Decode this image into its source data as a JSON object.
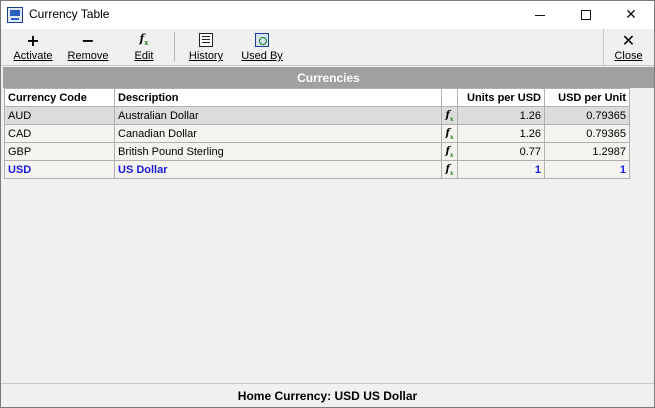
{
  "window": {
    "title": "Currency Table",
    "app_icon": "currency-window-icon"
  },
  "toolbar": {
    "activate": {
      "label": "Activate",
      "icon": "plus-icon"
    },
    "remove": {
      "label": "Remove",
      "icon": "minus-icon"
    },
    "edit": {
      "label": "Edit",
      "icon": "fx-icon"
    },
    "history": {
      "label": "History",
      "icon": "history-icon"
    },
    "used_by": {
      "label": "Used By",
      "icon": "used-by-icon"
    },
    "close": {
      "label": "Close",
      "icon": "close-icon"
    }
  },
  "grid": {
    "title": "Currencies",
    "columns": {
      "code": "Currency Code",
      "description": "Description",
      "units_per_usd": "Units per USD",
      "usd_per_unit": "USD per Unit"
    },
    "rows": [
      {
        "code": "AUD",
        "description": "Australian Dollar",
        "units_per_usd": "1.26",
        "usd_per_unit": "0.79365",
        "selected": true,
        "home": false
      },
      {
        "code": "CAD",
        "description": "Canadian Dollar",
        "units_per_usd": "1.26",
        "usd_per_unit": "0.79365",
        "selected": false,
        "home": false
      },
      {
        "code": "GBP",
        "description": "British Pound Sterling",
        "units_per_usd": "0.77",
        "usd_per_unit": "1.2987",
        "selected": false,
        "home": false
      },
      {
        "code": "USD",
        "description": "US Dollar",
        "units_per_usd": "1",
        "usd_per_unit": "1",
        "selected": false,
        "home": true
      }
    ]
  },
  "status": {
    "home_currency_label": "Home Currency:",
    "home_currency_code": "USD",
    "home_currency_name": "US Dollar"
  },
  "colors": {
    "home_row_text": "#1a1adf",
    "grid_title_bg": "#a0a0a0",
    "selected_row_bg": "#dcdcdc"
  }
}
